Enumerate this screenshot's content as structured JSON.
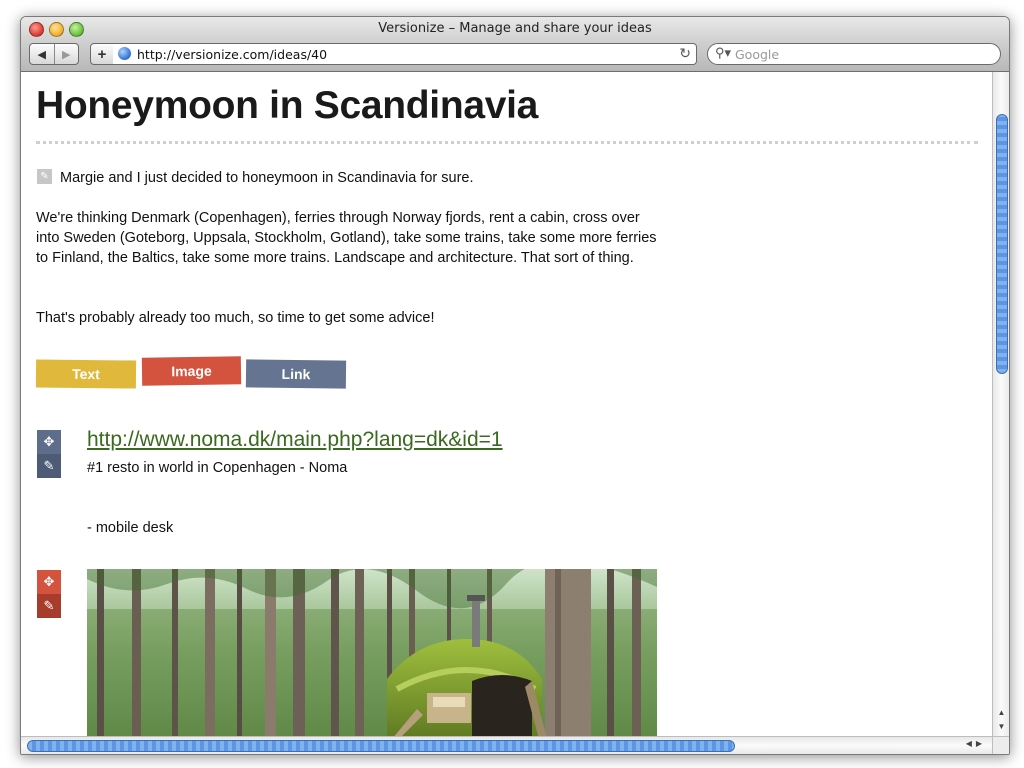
{
  "window": {
    "title": "Versionize – Manage and share your ideas",
    "url": "http://versionize.com/ideas/40",
    "search_placeholder": "Google"
  },
  "page": {
    "heading": "Honeymoon in Scandinavia",
    "paragraphs": [
      "Margie and I just decided to honeymoon in Scandinavia for sure.",
      "We're thinking Denmark (Copenhagen), ferries through Norway fjords, rent a cabin, cross over into Sweden (Goteborg, Uppsala, Stockholm, Gotland), take some trains, take some more ferries to Finland, the Baltics, take some more trains. Landscape and architecture. That sort of thing.",
      "That's probably already too much, so time to get some advice!"
    ],
    "add_buttons": {
      "text": "Text",
      "image": "Image",
      "link": "Link"
    },
    "link_item": {
      "url": "http://www.noma.dk/main.php?lang=dk&id=1",
      "description": "#1 resto in world in Copenhagen - Noma",
      "note": "- mobile desk"
    }
  },
  "colors": {
    "text_button": "#dfb83c",
    "image_button": "#d4533f",
    "link_button": "#657490",
    "link_color": "#3a6a1f"
  },
  "icons": [
    "back-arrow-icon",
    "forward-arrow-icon",
    "plus-icon",
    "globe-icon",
    "reload-icon",
    "search-icon",
    "pencil-icon",
    "move-icon"
  ]
}
